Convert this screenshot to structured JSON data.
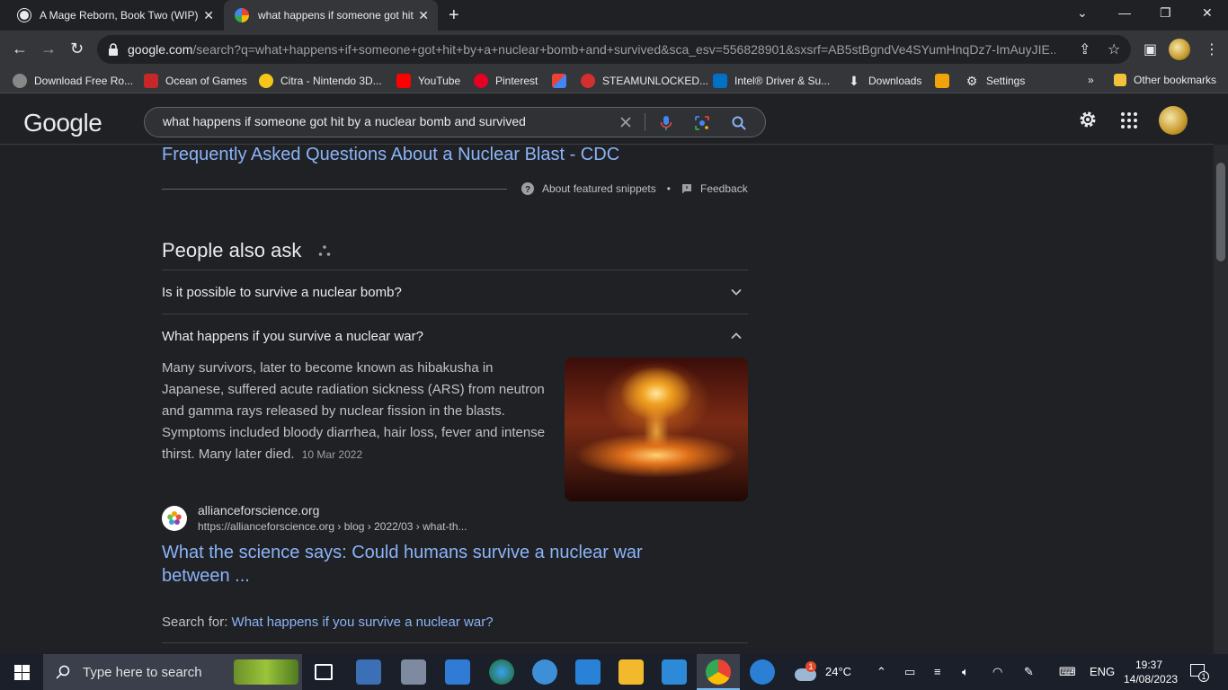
{
  "browser": {
    "tabs": [
      {
        "title": "A Mage Reborn, Book Two (WIP)",
        "active": false,
        "favicon": "openai-icon"
      },
      {
        "title": "what happens if someone got hit",
        "active": true,
        "favicon": "google-icon"
      }
    ],
    "address": {
      "domain": "google.com",
      "path": "/search?q=what+happens+if+someone+got+hit+by+a+nuclear+bomb+and+survived&sca_esv=556828901&sxsrf=AB5stBgndVe4SYumHnqDz7-ImAuyJIE..."
    },
    "bookmarks": [
      {
        "label": "Download Free Ro...",
        "color": "#888888"
      },
      {
        "label": "Ocean of Games",
        "color": "#c62828"
      },
      {
        "label": "Citra - Nintendo 3D...",
        "color": "#f5c518"
      },
      {
        "label": "YouTube",
        "color": "#ff0000"
      },
      {
        "label": "Pinterest",
        "color": "#e60023"
      },
      {
        "label": "",
        "color": "#ea4335"
      },
      {
        "label": "STEAMUNLOCKED...",
        "color": "#d32f2f"
      },
      {
        "label": "Intel® Driver & Su...",
        "color": "#0071c5"
      },
      {
        "label": "Downloads",
        "color": "#e8eaed"
      },
      {
        "label": "",
        "color": "#f0a30a"
      },
      {
        "label": "Settings",
        "color": "#e8eaed"
      }
    ],
    "bookmarks_more": "»",
    "other_bookmarks": "Other bookmarks"
  },
  "google": {
    "logo": "Google",
    "query": "what happens if someone got hit by a nuclear bomb and survived"
  },
  "results": {
    "featured_link": "Frequently Asked Questions About a Nuclear Blast - CDC",
    "about_snippets": "About featured snippets",
    "separator": "•",
    "feedback": "Feedback",
    "paa_title": "People also ask",
    "questions": [
      {
        "text": "Is it possible to survive a nuclear bomb?",
        "expanded": false
      },
      {
        "text": "What happens if you survive a nuclear war?",
        "expanded": true
      }
    ],
    "answer": "Many survivors, later to become known as hibakusha in Japanese, suffered acute radiation sickness (ARS) from neutron and gamma rays released by nuclear fission in the blasts. Symptoms included bloody diarrhea, hair loss, fever and intense thirst. Many later died.",
    "answer_date": "10 Mar 2022",
    "source_name": "allianceforscience.org",
    "source_url": "https://allianceforscience.org › blog › 2022/03 › what-th...",
    "result_title": "What the science says: Could humans survive a nuclear war between ...",
    "search_for_prefix": "Search for:",
    "search_for_link": "What happens if you survive a nuclear war?"
  },
  "taskbar": {
    "search_placeholder": "Type here to search",
    "weather": "24°C",
    "weather_badge": "1",
    "language": "ENG",
    "time": "19:37",
    "date": "14/08/2023",
    "notification_count": "1"
  }
}
